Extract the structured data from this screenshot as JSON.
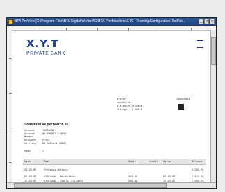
{
  "window": {
    "title": "BTA PreView [C:\\Program Files\\BTA Digital Works AG\\BTA PrintMachine 3.70 - Training\\Configuration Tool\\Ve..."
  },
  "controls": {
    "minimize": "_",
    "maximize": "□",
    "close": "x"
  },
  "bank": {
    "logo": "X.Y.T",
    "name": "PRIVATE BANK"
  },
  "address": {
    "lines": [
      "Mister",
      "Egm Miller",
      "414 North Orleans",
      "Chicago, IL 60610"
    ],
    "code": "CH0365034"
  },
  "statement": {
    "title": "Statement as per March 30",
    "fields": [
      {
        "label": "Account",
        "value": "CH034301"
      },
      {
        "label": "Account Number",
        "value": "01-698077.2-0202"
      },
      {
        "label": "Dispatch",
        "value": "Print"
      },
      {
        "label": "Currency",
        "value": "US Dollars (USD)"
      },
      {
        "label": "Page",
        "value": "1"
      }
    ]
  },
  "table": {
    "headers": [
      "Date",
      "Text",
      "Debit",
      "Credit",
      "Value",
      "Balance"
    ],
    "rows": [
      [
        "28.03.07",
        "Previous Balance",
        "",
        "",
        "",
        "6'982.29"
      ],
      [
        "02.03.07",
        "ATM Cash - North Bank",
        "500.00",
        "",
        "02.03.07",
        "7'482.29"
      ],
      [
        "12.03.07",
        "ATM Cash - 100 W. Illinois",
        "500.00",
        "",
        "12.03.07",
        "7'982.29"
      ]
    ]
  }
}
